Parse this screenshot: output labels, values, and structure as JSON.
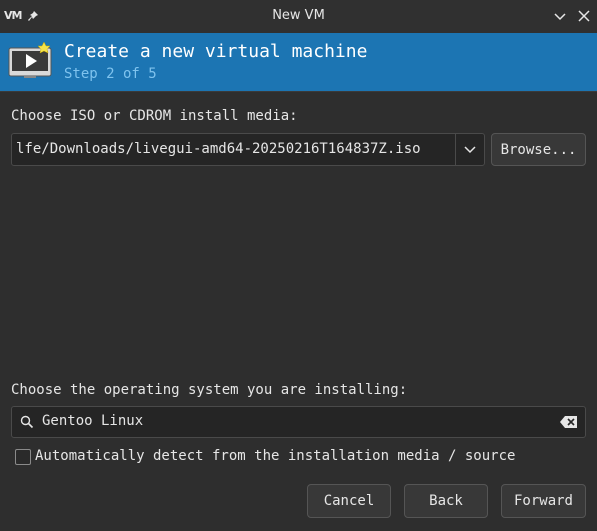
{
  "window": {
    "title": "New VM",
    "app_logo": "VM",
    "icons": {
      "pin": "pin-icon",
      "minimize": "chevron-down-icon",
      "close": "close-icon"
    }
  },
  "header": {
    "title": "Create a new virtual machine",
    "step": "Step 2 of 5",
    "icon": "monitor-play-icon",
    "colors": {
      "background": "#1c75b3",
      "step_text": "#7fc3ee"
    }
  },
  "install_media": {
    "label": "Choose ISO or CDROM install media:",
    "value": "lfe/Downloads/livegui-amd64-20250216T164837Z.iso",
    "browse_label": "Browse..."
  },
  "os": {
    "label": "Choose the operating system you are installing:",
    "value": "Gentoo Linux",
    "auto_detect_label": "Automatically detect from the installation media / source",
    "auto_detect_checked": false
  },
  "buttons": {
    "cancel": "Cancel",
    "back": "Back",
    "forward": "Forward"
  }
}
